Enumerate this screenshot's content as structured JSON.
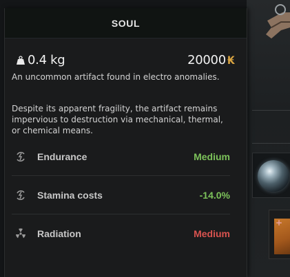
{
  "tooltip": {
    "title": "SOUL",
    "weight": "0.4 kg",
    "weight_icon": "weight-icon",
    "price": "20000",
    "currency_icon": "coupon-currency-icon",
    "currency_glyph": "₭",
    "description_1": "An uncommon artifact found in electro anomalies.",
    "description_2": "Despite its apparent fragility, the artifact remains impervious to destruction via mechanical, thermal, or chemical means.",
    "properties": [
      {
        "icon": "endurance-icon",
        "label": "Endurance",
        "value": "Medium",
        "value_color": "#7cc25a"
      },
      {
        "icon": "stamina-icon",
        "label": "Stamina costs",
        "value": "-14.0%",
        "value_color": "#7cc25a"
      },
      {
        "icon": "radiation-icon",
        "label": "Radiation",
        "value": "Medium",
        "value_color": "#d9534f"
      }
    ]
  },
  "colors": {
    "positive": "#7cc25a",
    "negative": "#d9534f",
    "currency": "#d9a441"
  }
}
